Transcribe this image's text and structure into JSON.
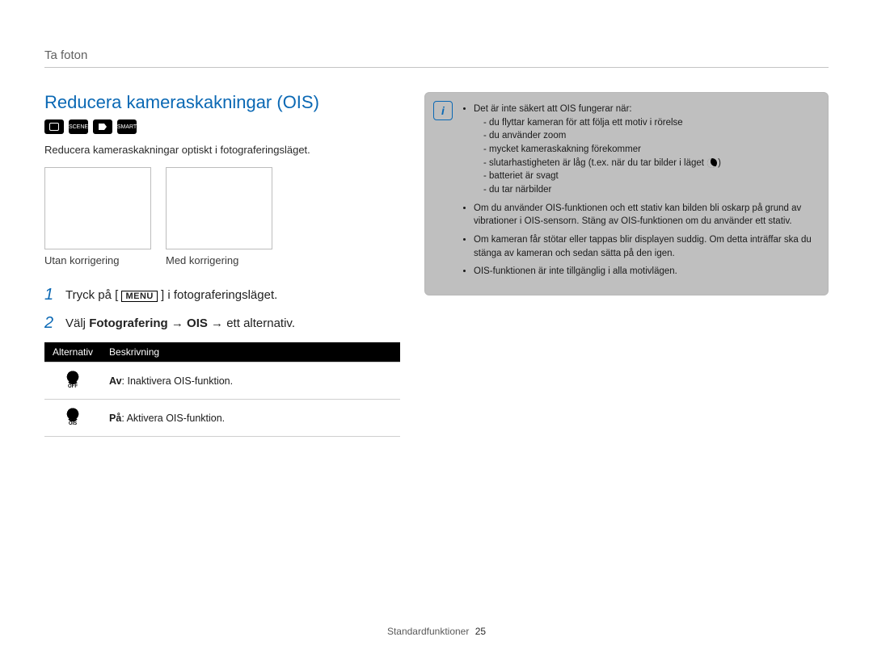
{
  "breadcrumb": "Ta foton",
  "heading": "Reducera    kameraskakningar (OIS)",
  "intro": "Reducera kameraskakningar optiskt i fotograferingsläget.",
  "captions": {
    "without": "Utan korrigering",
    "with": "Med korrigering"
  },
  "steps": {
    "s1_num": "1",
    "s1_pre": "Tryck på [",
    "s1_menu": "MENU",
    "s1_post": "] i fotograferingsläget.",
    "s2_num": "2",
    "s2_pre": "Välj ",
    "s2_bold1": "Fotografering",
    "s2_sep1": " → ",
    "s2_bold2": "OIS",
    "s2_sep2": " → ",
    "s2_post": "ett alternativ."
  },
  "table": {
    "headers": {
      "opt": "Alternativ",
      "desc": "Beskrivning"
    },
    "rows": {
      "off": {
        "label": "Av",
        "desc": ": Inaktivera OIS-funktion."
      },
      "on": {
        "label": "På",
        "desc": ": Aktivera OIS-funktion."
      }
    }
  },
  "note": {
    "l1": "Det är inte säkert att OIS fungerar när:",
    "sub": {
      "a": "du flyttar kameran för att följa ett motiv i rörelse",
      "b": "du använder zoom",
      "c": "mycket kameraskakning förekommer",
      "d_pre": "slutarhastigheten är låg (t.ex. när du tar bilder i läget ",
      "d_post": ")",
      "e": "batteriet är svagt",
      "f": "du tar närbilder"
    },
    "l2": "Om du använder OIS-funktionen och ett stativ kan bilden bli oskarp på grund av vibrationer i OIS-sensorn. Stäng av OIS-funktionen om du använder ett stativ.",
    "l3": "Om kameran får stötar eller tappas blir displayen suddig. Om detta inträffar ska du stänga av kameran och sedan sätta på den igen.",
    "l4": "OIS-funktionen är inte tillgänglig i alla motivlägen."
  },
  "footer": {
    "section": "Standardfunktioner",
    "page": "25"
  }
}
